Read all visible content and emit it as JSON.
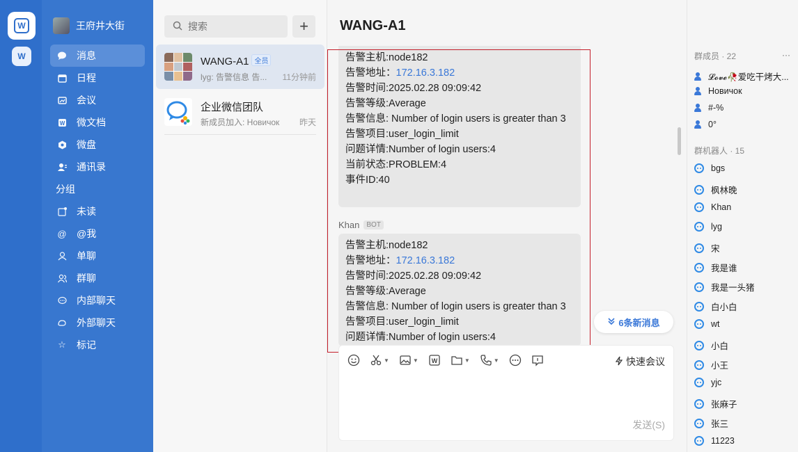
{
  "rail": {
    "active_app": "W",
    "second_app": "W"
  },
  "profile": {
    "name": "王府井大街"
  },
  "nav": {
    "items": [
      {
        "label": "消息",
        "icon": "chat-bubble-icon"
      },
      {
        "label": "日程",
        "icon": "calendar-icon"
      },
      {
        "label": "会议",
        "icon": "meeting-icon"
      },
      {
        "label": "微文档",
        "icon": "document-icon"
      },
      {
        "label": "微盘",
        "icon": "drive-icon"
      },
      {
        "label": "通讯录",
        "icon": "contacts-icon"
      }
    ],
    "group_title": "分组",
    "groups": [
      {
        "label": "未读",
        "icon": "unread-icon"
      },
      {
        "label": "@我",
        "icon": "at-icon"
      },
      {
        "label": "单聊",
        "icon": "single-chat-icon"
      },
      {
        "label": "群聊",
        "icon": "group-chat-icon"
      },
      {
        "label": "内部聊天",
        "icon": "internal-chat-icon"
      },
      {
        "label": "外部聊天",
        "icon": "external-chat-icon"
      },
      {
        "label": "标记",
        "icon": "star-icon"
      }
    ]
  },
  "search": {
    "placeholder": "搜索"
  },
  "conversations": [
    {
      "name": "WANG-A1",
      "badge": "全员",
      "preview": "lyg: 告警信息 告...",
      "time": "11分钟前"
    },
    {
      "name": "企业微信团队",
      "badge": "",
      "preview": "新成员加入: Новичок",
      "time": "昨天"
    }
  ],
  "chat": {
    "title": "WANG-A1",
    "message1": [
      "告警主机:node182",
      "告警地址：",
      "告警时间:2025.02.28 09:09:42",
      "告警等级:Average",
      "告警信息: Number of login users is greater than 3",
      "告警项目:user_login_limit",
      "问题详情:Number of login users:4",
      "当前状态:PROBLEM:4",
      "事件ID:40"
    ],
    "ip": "172.16.3.182",
    "sender": "Khan",
    "sender_badge": "BOT",
    "message2": [
      "告警主机:node182",
      "告警地址：",
      "告警时间:2025.02.28 09:09:42",
      "告警等级:Average",
      "告警信息: Number of login users is greater than 3",
      "告警项目:user_login_limit",
      "问题详情:Number of login users:4"
    ],
    "new_messages": "6条新消息",
    "quick_meeting": "快速会议",
    "send": "发送(S)"
  },
  "members": {
    "group_header": "群成员 · 22",
    "people": [
      "𝓛𝓸𝓿𝓮🥀爱吃干烤大...",
      "Новичок",
      "#-%",
      "0°"
    ],
    "bot_header": "群机器人 · 15",
    "bots": [
      "bgs",
      "枫林晚",
      "Khan",
      "lyg",
      "宋",
      "我是谁",
      "我是一头猪",
      "白小白",
      "wt",
      "小白",
      "小王",
      "yjc",
      "张麻子",
      "张三",
      "11223"
    ]
  },
  "colors": {
    "rail": "#2f6fcb",
    "nav": "#3877cf",
    "accent": "#3a78d8",
    "highlight": "#c41e2a"
  }
}
